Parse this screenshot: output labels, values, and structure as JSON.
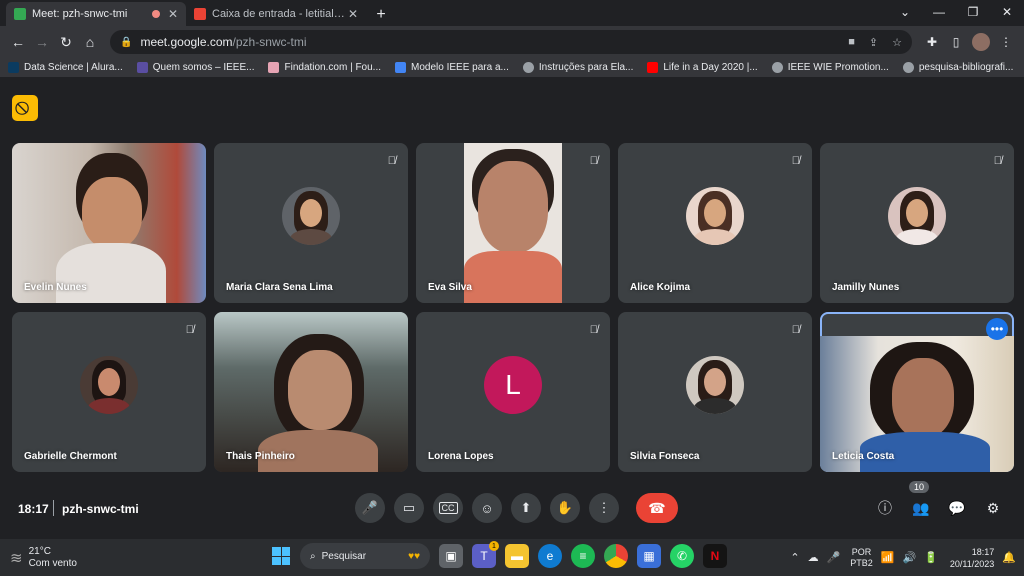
{
  "browser": {
    "tabs": [
      {
        "title": "Meet: pzh-snwc-tmi",
        "active": true,
        "favicon_color": "#34a853"
      },
      {
        "title": "Caixa de entrada - letitialobato@",
        "active": false,
        "favicon_color": "#ea4335"
      }
    ],
    "url_host": "meet.google.com",
    "url_path": "/pzh-snwc-tmi",
    "bookmarks": [
      {
        "label": "Data Science | Alura...",
        "icon_color": "#0b3b60"
      },
      {
        "label": "Quem somos – IEEE...",
        "icon_color": "#5a4ea2"
      },
      {
        "label": "Findation.com | Fou...",
        "icon_color": "#e6a4b4"
      },
      {
        "label": "Modelo IEEE para a...",
        "icon_color": "#4285f4"
      },
      {
        "label": "Instruções para Ela...",
        "icon_color": "#9aa0a6"
      },
      {
        "label": "Life in a Day 2020 |...",
        "icon_color": "#ff0000"
      },
      {
        "label": "IEEE WIE Promotion...",
        "icon_color": "#9aa0a6"
      },
      {
        "label": "pesquisa-bibliografi...",
        "icon_color": "#9aa0a6"
      }
    ]
  },
  "meet": {
    "time": "18:17",
    "code": "pzh-snwc-tmi",
    "people_count": "10",
    "participants": [
      {
        "name": "Evelin Nunes"
      },
      {
        "name": "Maria Clara Sena Lima"
      },
      {
        "name": "Eva Silva"
      },
      {
        "name": "Alice Kojima"
      },
      {
        "name": "Jamilly Nunes"
      },
      {
        "name": "Gabrielle Chermont"
      },
      {
        "name": "Thais Pinheiro"
      },
      {
        "name": "Lorena Lopes",
        "initial": "L"
      },
      {
        "name": "Silvia Fonseca"
      },
      {
        "name": "Leticia Costa"
      }
    ]
  },
  "taskbar": {
    "temperature": "21°C",
    "weather": "Com vento",
    "search_placeholder": "Pesquisar",
    "teams_badge": "1",
    "lang_top": "POR",
    "lang_bottom": "PTB2",
    "time": "18:17",
    "date": "20/11/2023"
  }
}
